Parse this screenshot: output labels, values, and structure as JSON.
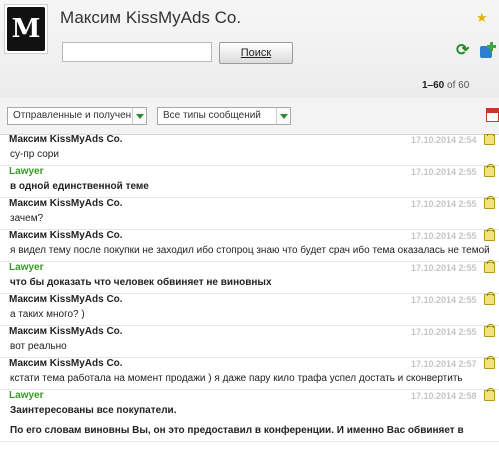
{
  "header": {
    "contact_name": "Максим KissMyAds Co.",
    "avatar_monogram": "M",
    "search": {
      "value": "",
      "placeholder": ""
    },
    "search_button_label": "Поиск",
    "pagination": {
      "range": "1–60",
      "of_label": "of",
      "total": "60"
    },
    "accent_color": "#2d8c2d"
  },
  "filters": {
    "direction": "Отправленные и получен…",
    "type": "Все типы сообщений"
  },
  "messages": [
    {
      "author": "Максим KissMyAds Co.",
      "author_type": "self",
      "time": "17.10.2014 2:54",
      "lines": [
        "су-пр сори"
      ],
      "bold": false
    },
    {
      "author": "Lawyer",
      "author_type": "lawyer",
      "time": "17.10.2014 2:55",
      "lines": [
        "в одной единственной теме"
      ],
      "bold": true
    },
    {
      "author": "Максим KissMyAds Co.",
      "author_type": "self",
      "time": "17.10.2014 2:55",
      "lines": [
        "зачем?"
      ],
      "bold": false
    },
    {
      "author": "Максим KissMyAds Co.",
      "author_type": "self",
      "time": "17.10.2014 2:55",
      "lines": [
        "я видел тему после покупки не заходил ибо стопроц знаю что будет срач ибо тема оказалась не темой"
      ],
      "bold": false
    },
    {
      "author": "Lawyer",
      "author_type": "lawyer",
      "time": "17.10.2014 2:55",
      "lines": [
        "что бы доказать что человек обвиняет не виновных"
      ],
      "bold": true
    },
    {
      "author": "Максим KissMyAds Co.",
      "author_type": "self",
      "time": "17.10.2014 2:55",
      "lines": [
        "а таких много? )"
      ],
      "bold": false
    },
    {
      "author": "Максим KissMyAds Co.",
      "author_type": "self",
      "time": "17.10.2014 2:55",
      "lines": [
        "вот реально"
      ],
      "bold": false
    },
    {
      "author": "Максим KissMyAds Co.",
      "author_type": "self",
      "time": "17.10.2014 2:57",
      "lines": [
        "кстати тема работала на момент продажи ) я даже пару кило трафа успел достать и сконвертить"
      ],
      "bold": false
    },
    {
      "author": "Lawyer",
      "author_type": "lawyer",
      "time": "17.10.2014 2:58",
      "lines": [
        "Заинтересованы все покупатели.",
        "По его словам виновны Вы, он это предоставил в конференции. И именно Вас обвиняет в"
      ],
      "bold": true
    }
  ]
}
